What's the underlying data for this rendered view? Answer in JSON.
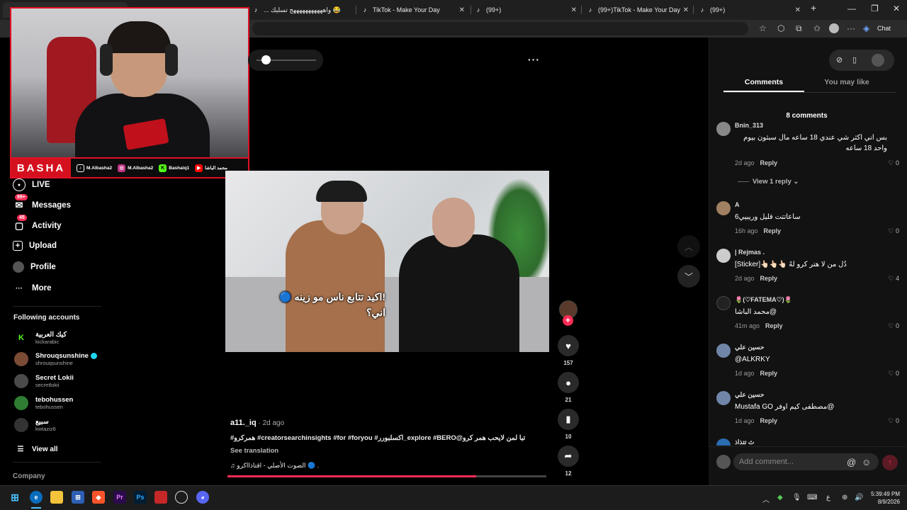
{
  "browser": {
    "tabs": [
      {
        "title": "",
        "active": true
      },
      {
        "title": "... واهههههههههههج تسليك 😂"
      },
      {
        "title": "TikTok - Make Your Day"
      },
      {
        "title": "(99+)"
      },
      {
        "title": "(99+)TikTok - Make Your Day"
      },
      {
        "title": "(99+)"
      }
    ],
    "new_tab": "+",
    "chat_label": "Chat"
  },
  "webcam": {
    "brand": "BASHA",
    "socials": [
      {
        "icon": "tiktok-icon",
        "label": "M.Albasha2",
        "color": "#000000"
      },
      {
        "icon": "instagram-icon",
        "label": "M.Albasha2",
        "color": "#c13584"
      },
      {
        "icon": "kick-icon",
        "label": "Bashaiq1",
        "color": "#53fc18"
      },
      {
        "icon": "youtube-icon",
        "label": "محمد الباشا",
        "color": "#ff0000"
      }
    ]
  },
  "sidebar": {
    "nav": [
      {
        "label": "LIVE",
        "icon": "live-icon"
      },
      {
        "label": "Messages",
        "icon": "messages-icon",
        "badge": "99+"
      },
      {
        "label": "Activity",
        "icon": "activity-icon",
        "badge": "45"
      },
      {
        "label": "Upload",
        "icon": "upload-icon"
      },
      {
        "label": "Profile",
        "icon": "profile-icon"
      },
      {
        "label": "More",
        "icon": "more-icon"
      }
    ],
    "following_title": "Following accounts",
    "following": [
      {
        "name": "كيك العربية",
        "handle": "kickarabic",
        "color": "#53fc18",
        "initial": "K"
      },
      {
        "name": "Shrouqsunshine",
        "handle": "shrouqsunshine",
        "color": "#7a4b35",
        "initial": "",
        "verified": true
      },
      {
        "name": "Secret Lokii",
        "handle": "secretlokii",
        "color": "#4a4a4a",
        "initial": ""
      },
      {
        "name": "tebohussen",
        "handle": "tebohussen",
        "color": "#2e7d32",
        "initial": ""
      },
      {
        "name": "سبيع",
        "handle": "kwtaziz6",
        "color": "#333333",
        "initial": ""
      }
    ],
    "view_all": "View all",
    "company": "Company"
  },
  "video": {
    "caption_line1": "!اكيد تتابع ناس مو زينه 🔵",
    "caption_line2": "اني؟",
    "author": "a11._iq",
    "date": " · 2d ago",
    "description": "#همركرو #creatorsearchinsights #for #foryou #اكسلبورر_explore #BERO@تبا لمن لايحب همر كرو",
    "see_translation": "See translation",
    "music": "♫  الصوت الأصلي - اقتاذااكرو 🔵 .",
    "progress": 0.78,
    "likes": "157",
    "comments": "21",
    "saves": "10",
    "shares": "12"
  },
  "panel": {
    "tab_comments": "Comments",
    "tab_may_like": "You may like",
    "comment_count": "8 comments",
    "view_reply": "View 1 reply",
    "reply_label": "Reply",
    "comments": [
      {
        "user": "Bnin_313",
        "text": "بس اني اكثر شي عندي 18 ساعه مال سبثون بيوم واحد 18 ساعه",
        "time": "2d ago",
        "likes": "0",
        "color": "#888"
      },
      {
        "user": "A",
        "text": "ساعاتتت قليل وريبيي6",
        "time": "16h ago",
        "likes": "0",
        "color": "#a08060"
      },
      {
        "user": "| Rejmas .",
        "text": "دُل من لا هتر كرو لهٌ 👆🏻👆🏻👆🏻[Sticker]",
        "time": "2d ago",
        "likes": "4",
        "color": "#ccc"
      },
      {
        "user": "🌷(♡FATEMA♡)🌷",
        "text": "@محمد الباشا",
        "time": "41m ago",
        "likes": "0",
        "color": "#222"
      },
      {
        "user": "حسين علي",
        "text": "@ALKRKY",
        "time": "1d ago",
        "likes": "0",
        "color": "#6f86a8"
      },
      {
        "user": "حسين علي",
        "text": "@مصطفى كيم اوفر Mustafa GO",
        "time": "1d ago",
        "likes": "0",
        "color": "#6f86a8"
      },
      {
        "user": "ث تتذاذ",
        "text": "",
        "time": "",
        "likes": "",
        "color": "#2a6db0"
      }
    ],
    "add_comment_placeholder": "Add comment..."
  },
  "taskbar": {
    "time": "5:39:49 PM",
    "date": "8/9/2026",
    "lang": "ع"
  }
}
